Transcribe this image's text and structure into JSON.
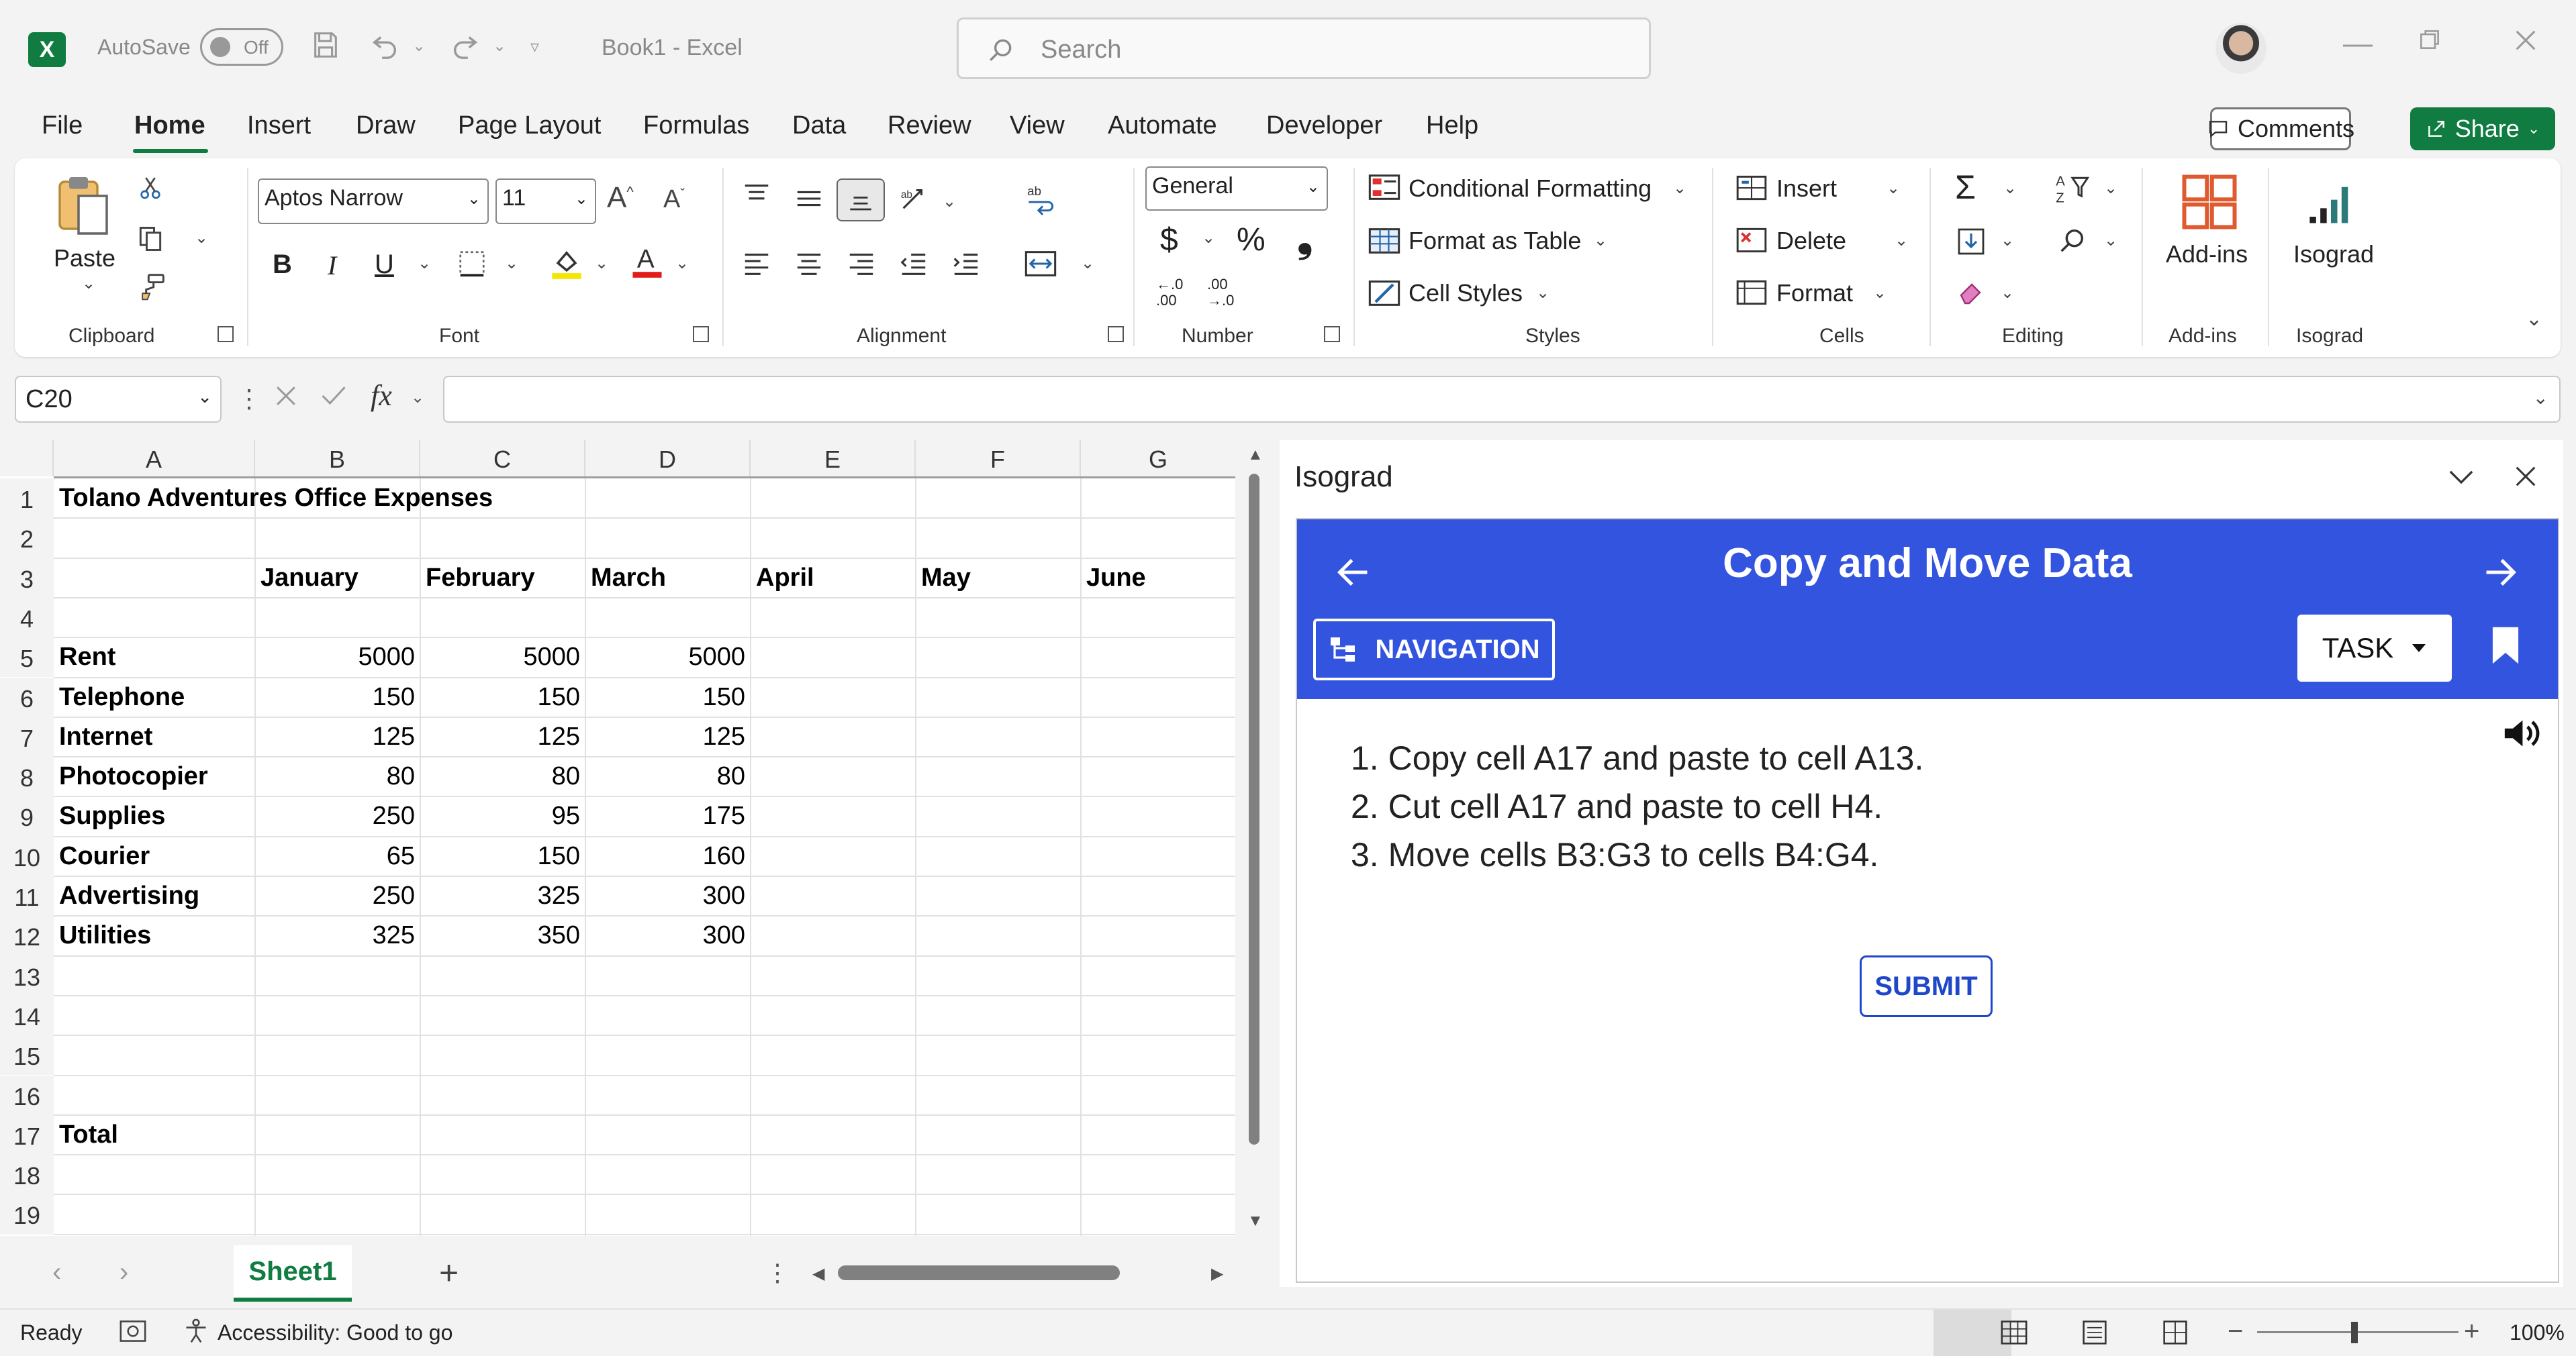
{
  "titlebar": {
    "app_logo": "X",
    "autosave_label": "AutoSave",
    "autosave_state": "Off",
    "doc_title": "Book1  -  Excel",
    "search_placeholder": "Search"
  },
  "tabs": [
    "File",
    "Home",
    "Insert",
    "Draw",
    "Page Layout",
    "Formulas",
    "Data",
    "Review",
    "View",
    "Automate",
    "Developer",
    "Help"
  ],
  "active_tab": "Home",
  "buttons": {
    "comments": "Comments",
    "share": "Share"
  },
  "ribbon": {
    "clipboard": {
      "paste": "Paste",
      "label": "Clipboard"
    },
    "font": {
      "name": "Aptos Narrow",
      "size": "11",
      "label": "Font",
      "bold": "B",
      "italic": "I",
      "underline": "U"
    },
    "alignment": {
      "label": "Alignment"
    },
    "number": {
      "format": "General",
      "currency": "$",
      "percent": "%",
      "comma": "❟",
      "inc_decimal": "←.0 .00",
      "dec_decimal": ".00 →.0",
      "label": "Number"
    },
    "styles": {
      "conditional": "Conditional Formatting",
      "format_table": "Format as Table",
      "cell_styles": "Cell Styles",
      "label": "Styles"
    },
    "cells": {
      "insert": "Insert",
      "delete": "Delete",
      "format": "Format",
      "label": "Cells"
    },
    "editing": {
      "label": "Editing"
    },
    "addins": {
      "button": "Add-ins",
      "label": "Add-ins"
    },
    "isograd": {
      "button": "Isograd",
      "label": "Isograd"
    }
  },
  "formula_bar": {
    "name_box": "C20",
    "fx": "fx",
    "value": ""
  },
  "sheet": {
    "columns": [
      "A",
      "B",
      "C",
      "D",
      "E",
      "F",
      "G"
    ],
    "rows": [
      "1",
      "2",
      "3",
      "4",
      "5",
      "6",
      "7",
      "8",
      "9",
      "10",
      "11",
      "12",
      "13",
      "14",
      "15",
      "16",
      "17",
      "18",
      "19"
    ],
    "title": "Tolano Adventures Office Expenses",
    "months": [
      "January",
      "February",
      "March",
      "April",
      "May",
      "June"
    ],
    "data": [
      {
        "label": "Rent",
        "values": [
          "5000",
          "5000",
          "5000"
        ]
      },
      {
        "label": "Telephone",
        "values": [
          "150",
          "150",
          "150"
        ]
      },
      {
        "label": "Internet",
        "values": [
          "125",
          "125",
          "125"
        ]
      },
      {
        "label": "Photocopier",
        "values": [
          "80",
          "80",
          "80"
        ]
      },
      {
        "label": "Supplies",
        "values": [
          "250",
          "95",
          "175"
        ]
      },
      {
        "label": "Courier",
        "values": [
          "65",
          "150",
          "160"
        ]
      },
      {
        "label": "Advertising",
        "values": [
          "250",
          "325",
          "300"
        ]
      },
      {
        "label": "Utilities",
        "values": [
          "325",
          "350",
          "300"
        ]
      }
    ],
    "total_label": "Total",
    "sheet_tab": "Sheet1"
  },
  "statusbar": {
    "ready": "Ready",
    "accessibility": "Accessibility: Good to go",
    "zoom": "100%"
  },
  "pane": {
    "title": "Isograd",
    "task_title": "Copy and Move Data",
    "navigation": "NAVIGATION",
    "task_dropdown": "TASK",
    "instructions": [
      "1. Copy cell A17 and paste to cell A13.",
      "2. Cut cell A17 and paste to cell H4.",
      "3. Move cells B3:G3 to cells B4:G4."
    ],
    "submit": "SUBMIT"
  },
  "colors": {
    "excel_green": "#107c41",
    "task_blue": "#3354de",
    "submit_blue": "#1f47c9"
  }
}
